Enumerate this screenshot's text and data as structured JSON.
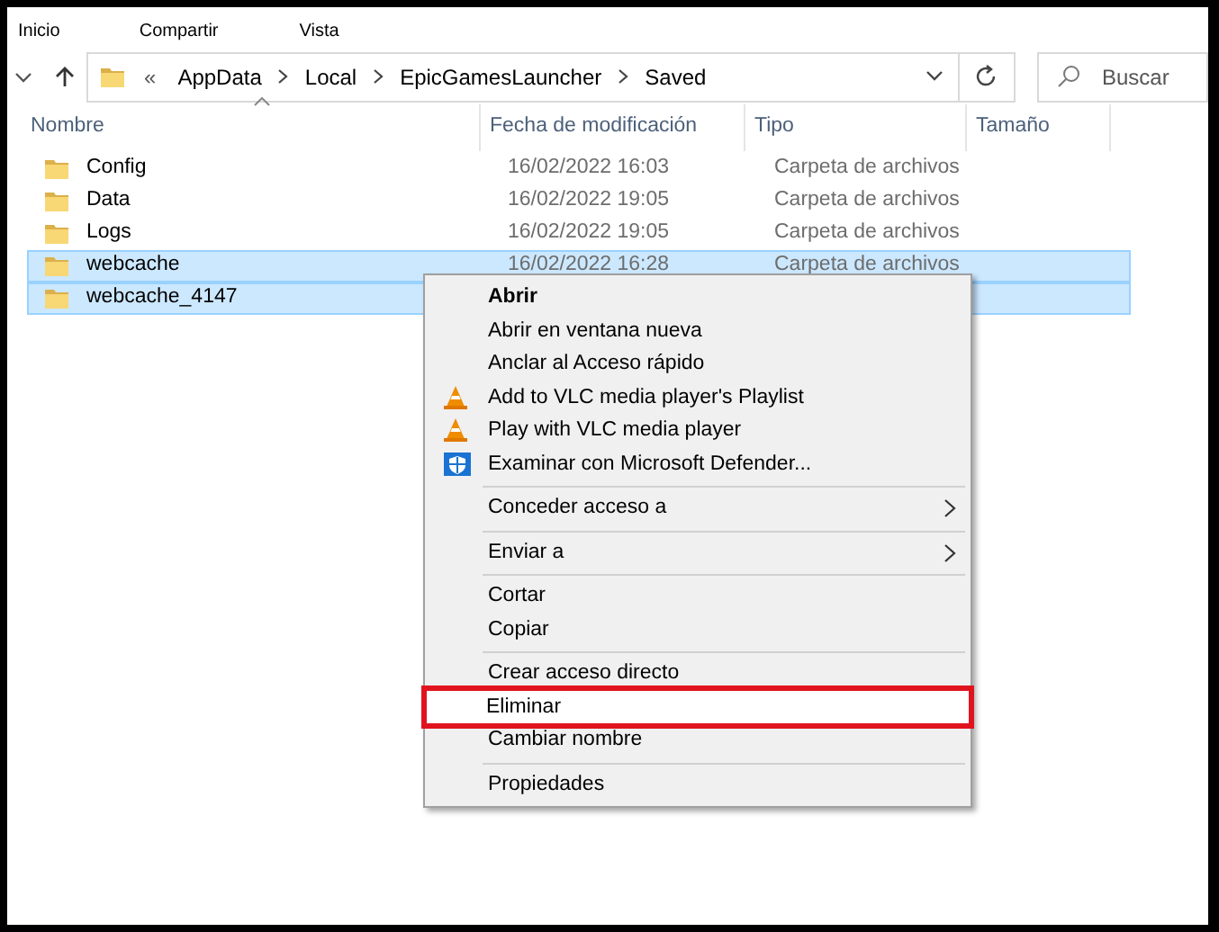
{
  "ribbon_tabs": [
    {
      "label": "Inicio"
    },
    {
      "label": "Compartir"
    },
    {
      "label": "Vista"
    }
  ],
  "address_bar": {
    "overflow": "«",
    "crumbs": [
      "AppData",
      "Local",
      "EpicGamesLauncher",
      "Saved"
    ]
  },
  "search": {
    "placeholder": "Buscar"
  },
  "table": {
    "columns": [
      "Nombre",
      "Fecha de modificación",
      "Tipo",
      "Tamaño"
    ],
    "rows": [
      {
        "name": "Config",
        "modified": "16/02/2022 16:03",
        "type": "Carpeta de archivos",
        "selected": false
      },
      {
        "name": "Data",
        "modified": "16/02/2022 19:05",
        "type": "Carpeta de archivos",
        "selected": false
      },
      {
        "name": "Logs",
        "modified": "16/02/2022 19:05",
        "type": "Carpeta de archivos",
        "selected": false
      },
      {
        "name": "webcache",
        "modified": "16/02/2022 16:28",
        "type": "Carpeta de archivos",
        "selected": true
      },
      {
        "name": "webcache_4147",
        "selected": true
      }
    ]
  },
  "context_menu": {
    "items": [
      {
        "kind": "item",
        "label": "Abrir",
        "default": true
      },
      {
        "kind": "item",
        "label": "Abrir en ventana nueva"
      },
      {
        "kind": "item",
        "label": "Anclar al Acceso rápido"
      },
      {
        "kind": "cone",
        "label": "Add to VLC media player's Playlist"
      },
      {
        "kind": "cone",
        "label": "Play with VLC media player"
      },
      {
        "kind": "shield",
        "label": "Examinar con Microsoft Defender..."
      },
      {
        "kind": "separator"
      },
      {
        "kind": "submenu",
        "label": "Conceder acceso a"
      },
      {
        "kind": "separator"
      },
      {
        "kind": "submenu",
        "label": "Enviar a"
      },
      {
        "kind": "separator"
      },
      {
        "kind": "item",
        "label": "Cortar"
      },
      {
        "kind": "item",
        "label": "Copiar"
      },
      {
        "kind": "separator"
      },
      {
        "kind": "item",
        "label": "Crear acceso directo"
      },
      {
        "kind": "item",
        "label": "Eliminar",
        "highlighted": true
      },
      {
        "kind": "item",
        "label": "Cambiar nombre"
      },
      {
        "kind": "separator"
      },
      {
        "kind": "item",
        "label": "Propiedades"
      }
    ]
  }
}
